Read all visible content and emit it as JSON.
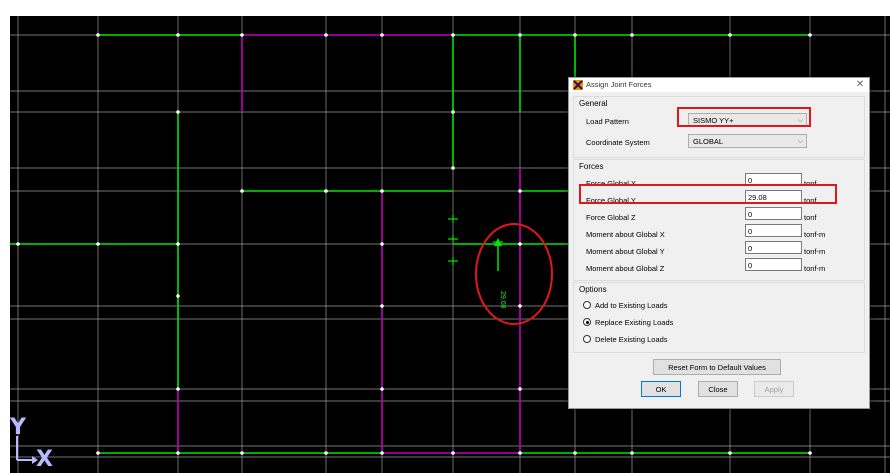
{
  "colors": {
    "canvas_bg": "#000000",
    "grid_line": "#9a9a9a",
    "beam_green": "#00e600",
    "beam_magenta": "#c000c0",
    "joint": "#ffffff",
    "highlight_red": "#e0181a",
    "axis_blue": "#b9b9ff"
  },
  "canvas": {
    "axis_y_label": "Y",
    "axis_x_label": "X",
    "load_arrow_label": "29.08",
    "callout_shape": "ellipse"
  },
  "dialog": {
    "title": "Assign Joint Forces",
    "icon": "sap-app-icon",
    "close_glyph": "✕",
    "general": {
      "title": "General",
      "load_pattern_label": "Load Pattern",
      "load_pattern_value": "SISMO YY+",
      "coord_system_label": "Coordinate System",
      "coord_system_value": "GLOBAL"
    },
    "forces": {
      "title": "Forces",
      "unit_force": "tonf",
      "unit_moment": "tonf-m",
      "rows": [
        {
          "label": "Force Global X",
          "value": "0",
          "unit": "tonf"
        },
        {
          "label": "Force Global Y",
          "value": "29.08",
          "unit": "tonf"
        },
        {
          "label": "Force Global Z",
          "value": "0",
          "unit": "tonf"
        },
        {
          "label": "Moment about Global X",
          "value": "0",
          "unit": "tonf-m"
        },
        {
          "label": "Moment about Global Y",
          "value": "0",
          "unit": "tonf-m"
        },
        {
          "label": "Moment about Global Z",
          "value": "0",
          "unit": "tonf-m"
        }
      ]
    },
    "options": {
      "title": "Options",
      "items": [
        {
          "label": "Add to Existing Loads",
          "checked": false
        },
        {
          "label": "Replace Existing Loads",
          "checked": true
        },
        {
          "label": "Delete Existing Loads",
          "checked": false
        }
      ]
    },
    "buttons": {
      "reset": "Reset Form to Default Values",
      "ok": "OK",
      "close": "Close",
      "apply": "Apply"
    }
  }
}
